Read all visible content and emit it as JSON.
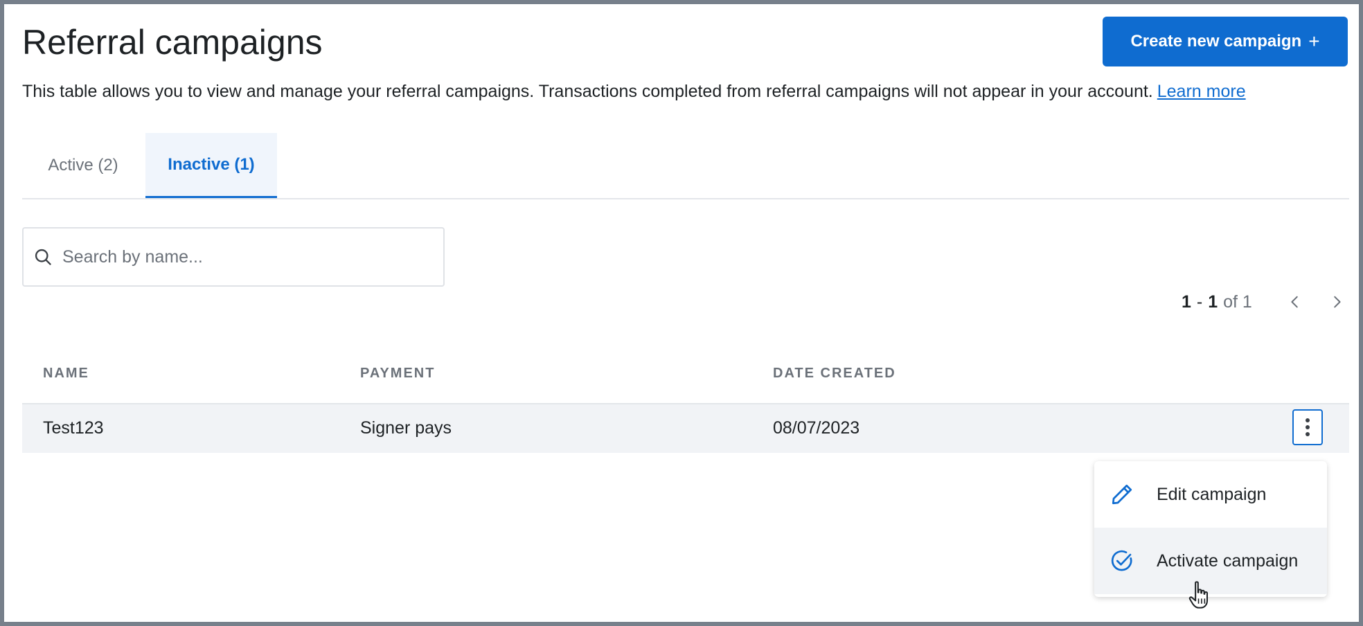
{
  "header": {
    "title": "Referral campaigns",
    "create_button_label": "Create new campaign",
    "create_button_icon": "plus-icon"
  },
  "description": {
    "text": "This table allows you to view and manage your referral campaigns. Transactions completed from referral campaigns will not appear in your account.",
    "link_label": "Learn more"
  },
  "tabs": [
    {
      "label": "Active (2)",
      "selected": false
    },
    {
      "label": "Inactive (1)",
      "selected": true
    }
  ],
  "search": {
    "placeholder": "Search by name...",
    "value": "",
    "icon": "search-icon"
  },
  "pagination": {
    "start": "1",
    "separator": "-",
    "end": "1",
    "of_label": "of 1",
    "prev_icon": "chevron-left-icon",
    "next_icon": "chevron-right-icon"
  },
  "table": {
    "columns": [
      "NAME",
      "PAYMENT",
      "DATE CREATED"
    ],
    "rows": [
      {
        "name": "Test123",
        "payment": "Signer pays",
        "date_created": "08/07/2023"
      }
    ]
  },
  "row_menu": {
    "icon": "kebab-menu-icon",
    "items": [
      {
        "label": "Edit campaign",
        "icon": "pencil-icon"
      },
      {
        "label": "Activate campaign",
        "icon": "check-circle-icon"
      }
    ]
  },
  "colors": {
    "accent": "#0f6cd0",
    "text": "#1d2124",
    "muted": "#6b7179",
    "row_bg": "#f1f3f6",
    "frame": "#77808b"
  }
}
